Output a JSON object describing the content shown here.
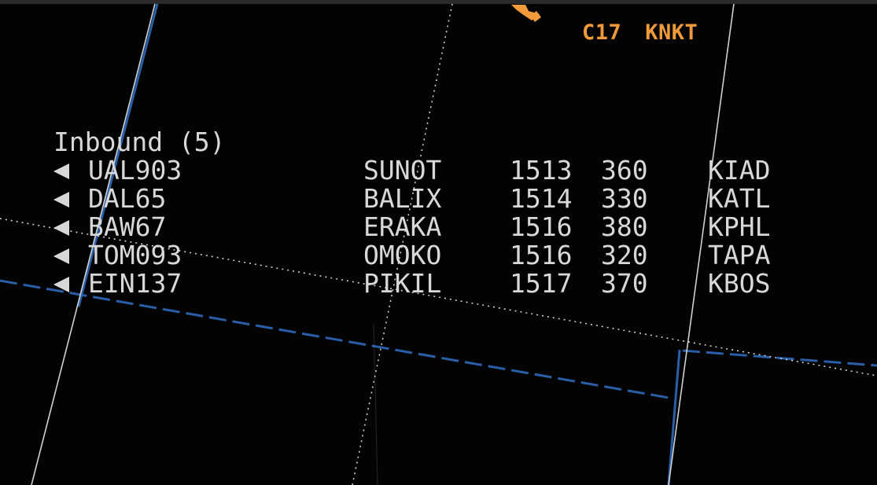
{
  "fix_labels": {
    "c17": "C17",
    "knkt": "KNKT"
  },
  "inbound": {
    "header": "Inbound (5)",
    "rows": [
      {
        "callsign": "UAL903",
        "fix": "SUNOT",
        "time": "1513",
        "alt": "360",
        "dest": "KIAD"
      },
      {
        "callsign": "DAL65",
        "fix": "BALIX",
        "time": "1514",
        "alt": "330",
        "dest": "KATL"
      },
      {
        "callsign": "BAW67",
        "fix": "ERAKA",
        "time": "1516",
        "alt": "380",
        "dest": "KPHL"
      },
      {
        "callsign": "TOM093",
        "fix": "OMOKO",
        "time": "1516",
        "alt": "320",
        "dest": "TAPA"
      },
      {
        "callsign": "EIN137",
        "fix": "PIKIL",
        "time": "1517",
        "alt": "370",
        "dest": "KBOS"
      }
    ]
  },
  "colors": {
    "background": "#030303",
    "text": "#d8d8d8",
    "fix_label": "#f09a3a",
    "airway_blue": "#2a5ea8",
    "grid_line": "#cfcfcf"
  },
  "icons": {
    "row_arrow": "triangle-left-icon",
    "aircraft_symbol": "aircraft-icon"
  }
}
